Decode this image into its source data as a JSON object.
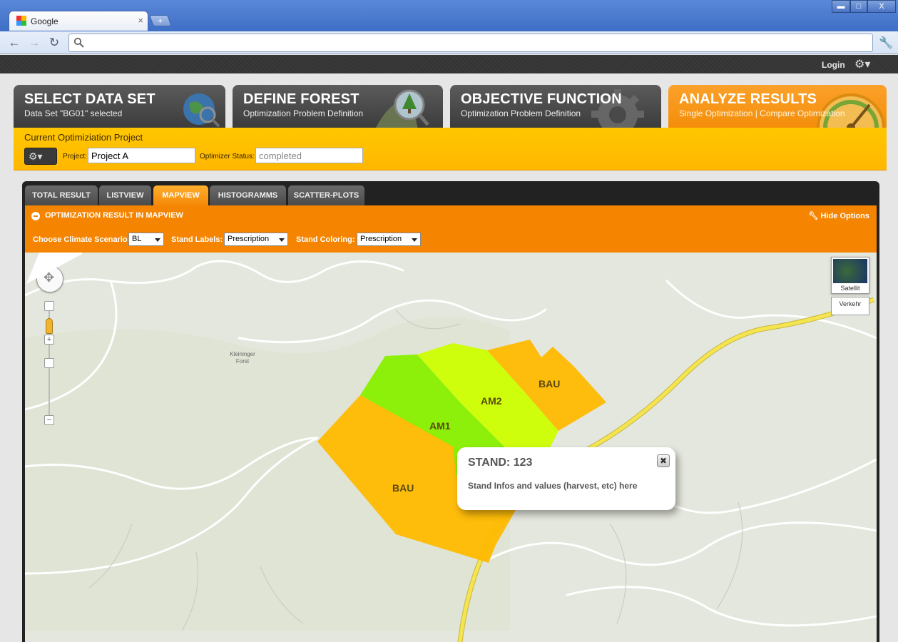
{
  "browser": {
    "tab_title": "Google",
    "tab_close": "×",
    "new_tab": "+",
    "win_min": "▬",
    "win_max": "□",
    "win_close": "X",
    "back": "←",
    "forward": "→",
    "reload": "↻",
    "address": "",
    "menu": "🔧"
  },
  "app": {
    "login": "Login",
    "gear": "⚙▾"
  },
  "steps": [
    {
      "title": "SELECT DATA SET",
      "subtitle": "Data Set \"BG01\" selected"
    },
    {
      "title": "DEFINE FOREST",
      "subtitle": "Optimization Problem Definition"
    },
    {
      "title": "OBJECTIVE FUNCTION",
      "subtitle": "Optimization Problem Definition"
    },
    {
      "title": "ANALYZE RESULTS",
      "subtitle": "Single Optimization | Compare Optimization"
    }
  ],
  "project": {
    "heading": "Current Optimiziation Project",
    "gear": "⚙▾",
    "project_label": "Project:",
    "project_value": "Project A",
    "status_label": "Optimizer Status:",
    "status_value": "completed"
  },
  "result_tabs": [
    "TOTAL RESULT",
    "LISTVIEW",
    "MAPVIEW",
    "HISTOGRAMMS",
    "SCATTER-PLOTS"
  ],
  "result_panel": {
    "title": "OPTIMIZATION RESULT IN MAPVIEW",
    "hide_options": "Hide Options",
    "climate_label": "Choose Climate Scenario:",
    "climate_value": "BL",
    "labels_label": "Stand Labels:",
    "labels_value": "Prescription",
    "coloring_label": "Stand Coloring:",
    "coloring_value": "Prescription"
  },
  "map": {
    "maptype_label": "Satellit",
    "traffic_label": "Verkehr",
    "pan_glyph": "✥",
    "zoom_in": "+",
    "zoom_out": "−",
    "poi_forst": "Kleininger Forst",
    "stands": [
      {
        "label": "BAU",
        "color": "#ffb900"
      },
      {
        "label": "AM1",
        "color": "#88f000"
      },
      {
        "label": "AM2",
        "color": "#ccff00"
      },
      {
        "label": "BAU",
        "color": "#ffb900"
      }
    ]
  },
  "infowindow": {
    "title": "STAND: 123",
    "body": "Stand  Infos and values (harvest, etc) here",
    "close": "✖"
  },
  "colors": {
    "accent_orange": "#f58400",
    "project_yellow": "#ffbb00",
    "road_yellow": "#f4e550",
    "dark_tab": "#4a4a4a"
  }
}
